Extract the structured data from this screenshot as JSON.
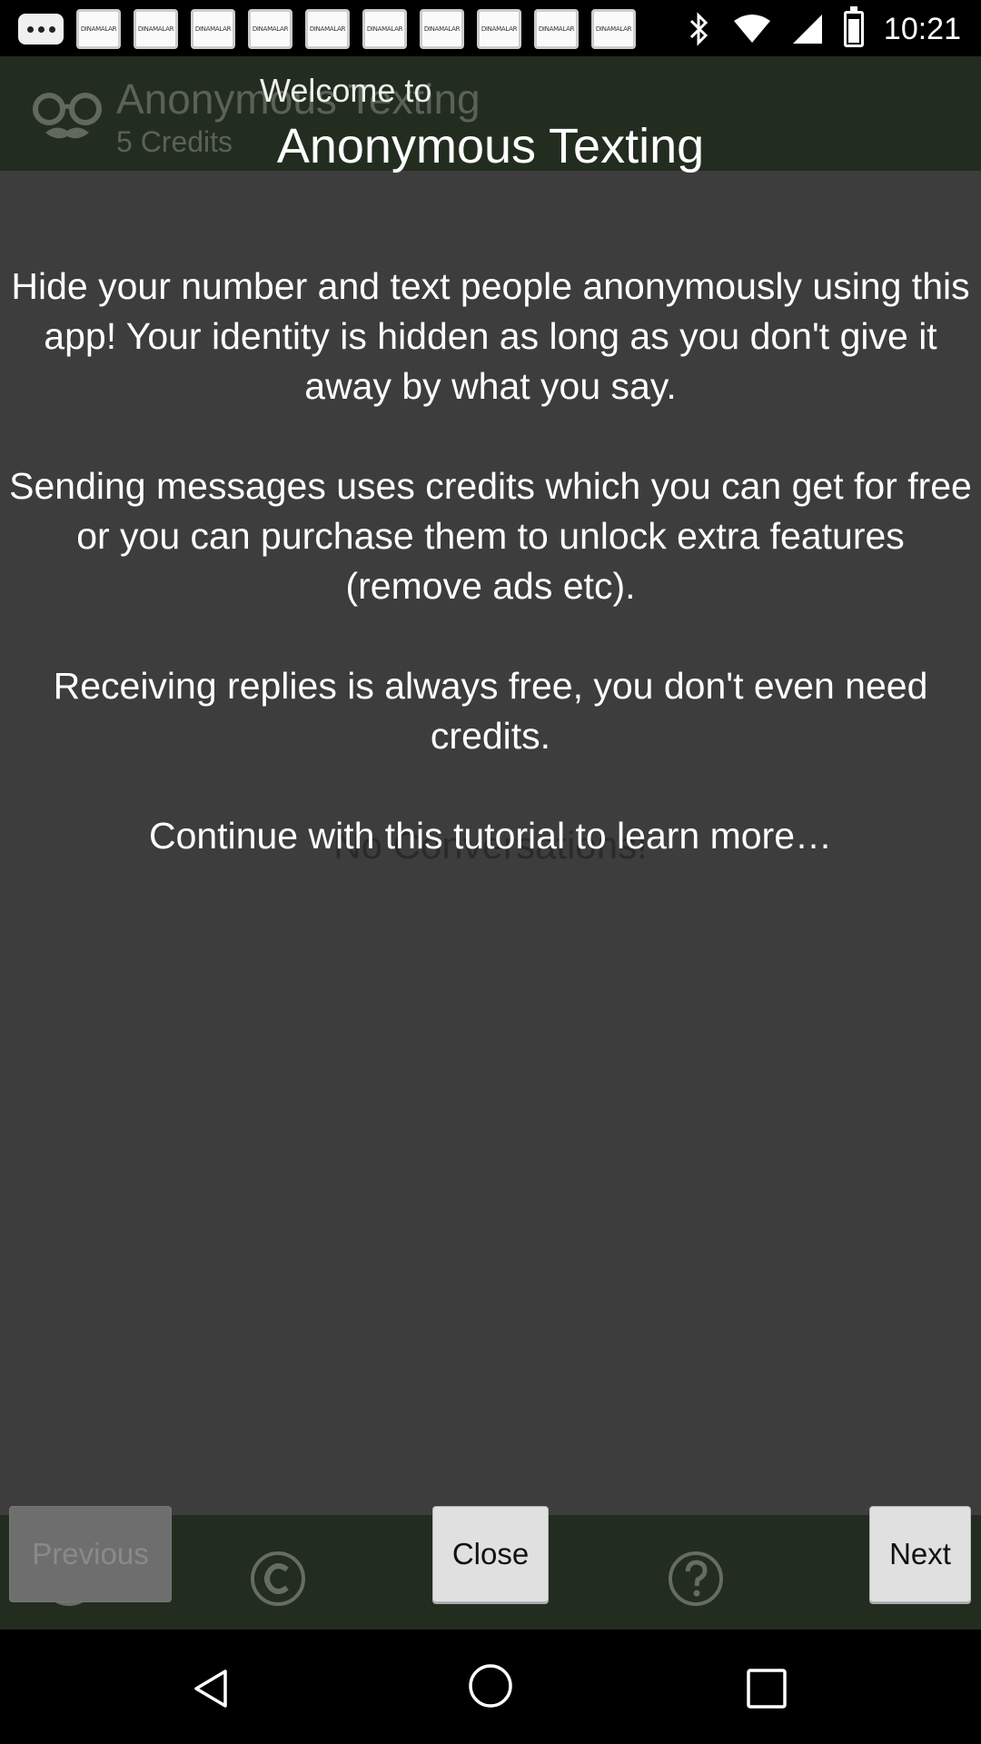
{
  "status_bar": {
    "time": "10:21",
    "notification_label": "DINAMALAR",
    "notification_count": 10
  },
  "app": {
    "header_title": "Anonymous Texting",
    "credits": "5 Credits",
    "empty_state": "No Conversations!"
  },
  "tutorial": {
    "subtitle": "Welcome to",
    "title": "Anonymous Texting",
    "paragraphs": [
      "Hide your number and text people anonymously using this app! Your identity is hidden as long as you don't give it away by what you say.",
      "Sending messages uses credits which you can get for free or you can purchase them to unlock extra features (remove ads etc).",
      "Receiving replies is always free, you don't even need credits.",
      "Continue with this tutorial to learn more…"
    ]
  },
  "buttons": {
    "previous": "Previous",
    "close": "Close",
    "next": "Next"
  },
  "colors": {
    "header": "#222c1f",
    "background": "#3d3d3d",
    "button": "#e0e0e0"
  }
}
